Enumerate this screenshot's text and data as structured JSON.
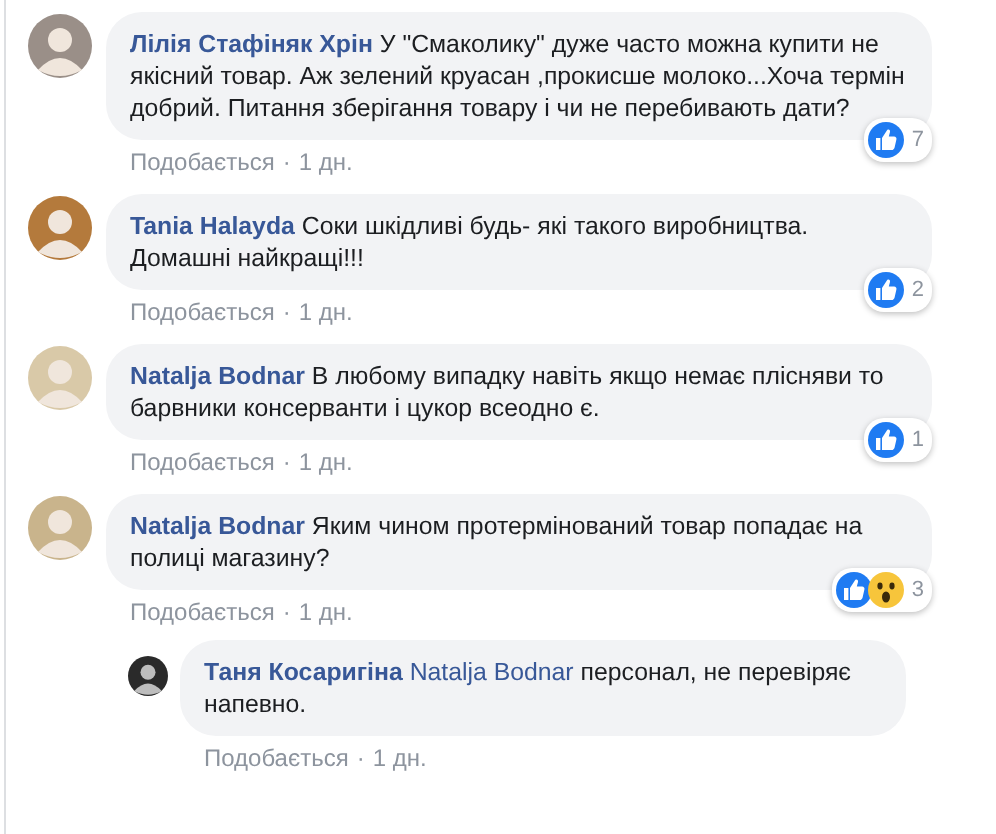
{
  "comments": [
    {
      "author": "Лілія Стафіняк Хрін",
      "text": "У \"Смаколику\" дуже часто можна купити не якісний товар. Аж зелений круасан ,прокисше молоко...Хоча термін добрий. Питання зберігання товару і чи не перебивають дати?",
      "reactions": [
        {
          "kind": "like"
        }
      ],
      "count": "7",
      "like_label": "Подобається",
      "separator": "·",
      "time": "1 дн."
    },
    {
      "author": "Tania Halayda",
      "text": "Соки шкідливі будь- які такого виробництва. Домашні найкращі!!!",
      "reactions": [
        {
          "kind": "like"
        }
      ],
      "count": "2",
      "like_label": "Подобається",
      "separator": "·",
      "time": "1 дн."
    },
    {
      "author": "Natalja Bodnar",
      "text": "В любому випадку навіть якщо немає плісняви то барвники консерванти і цукор всеодно є.",
      "reactions": [
        {
          "kind": "like"
        }
      ],
      "count": "1",
      "like_label": "Подобається",
      "separator": "·",
      "time": "1 дн."
    },
    {
      "author": "Natalja Bodnar",
      "text": "Яким чином протермінований товар попадає на полиці магазину?",
      "reactions": [
        {
          "kind": "like"
        },
        {
          "kind": "wow"
        }
      ],
      "count": "3",
      "like_label": "Подобається",
      "separator": "·",
      "time": "1 дн.",
      "replies": [
        {
          "author": "Таня Косаригіна",
          "mention": "Natalja Bodnar",
          "text": "персонал, не перевіряє напевно.",
          "like_label": "Подобається",
          "separator": "·",
          "time": "1 дн."
        }
      ]
    }
  ]
}
